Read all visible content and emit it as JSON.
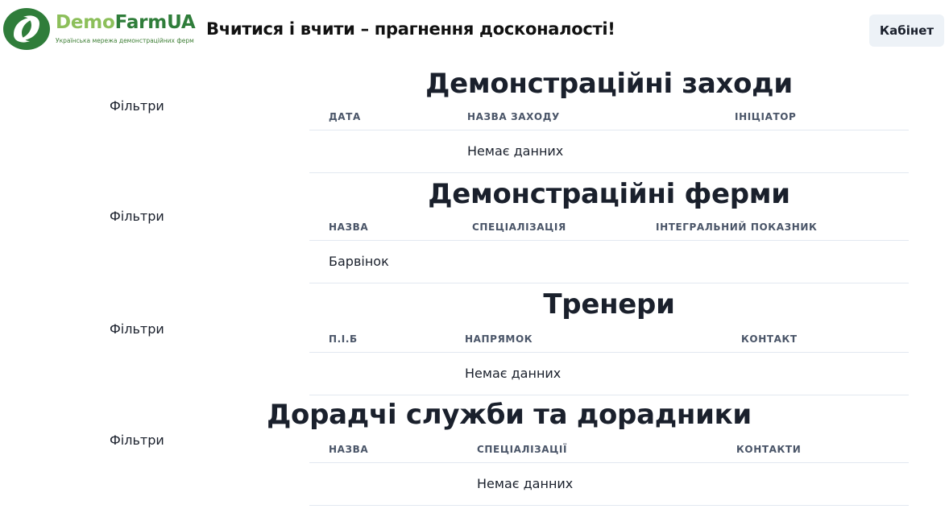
{
  "header": {
    "logo": {
      "name_demo": "Demo",
      "name_farm": "FarmUA",
      "subtitle": "Українська мережа демонстраційних ферм"
    },
    "slogan": "Вчитися і вчити – прагнення досконалості!",
    "cabinet_label": "Кабінет"
  },
  "filters_label": "Фільтри",
  "colors": {
    "logo_light": "#8cbf5a",
    "logo_dark": "#2f7d3a",
    "button_bg": "#edf2f7",
    "divider": "#e2e8f0"
  },
  "sections": [
    {
      "title": "Демонстраційні заходи",
      "columns": [
        "Дата",
        "Назва заходу",
        "Ініціатор"
      ],
      "rows": [
        [
          "",
          "Немає данних",
          ""
        ]
      ]
    },
    {
      "title": "Демонстраційні ферми",
      "columns": [
        "Назва",
        "Спеціалізація",
        "Інтегральний показник"
      ],
      "rows": [
        [
          "Барвінок",
          "",
          ""
        ]
      ]
    },
    {
      "title": "Тренери",
      "columns": [
        "П.І.Б",
        "Напрямок",
        "Контакт"
      ],
      "rows": [
        [
          "",
          "Немає данних",
          ""
        ]
      ]
    },
    {
      "title": "Дорадчі служби та дорадники",
      "columns": [
        "Назва",
        "Спеціалізації",
        "Контакти"
      ],
      "rows": [
        [
          "",
          "Немає данних",
          ""
        ]
      ]
    }
  ]
}
